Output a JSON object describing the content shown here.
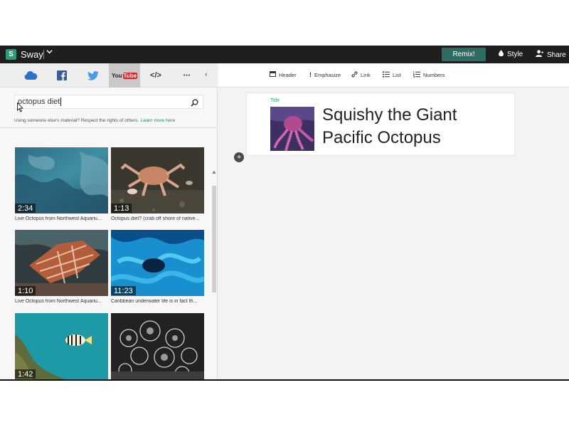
{
  "colors": {
    "topbar": "#1f1f1f",
    "accent": "#2e6b62",
    "link": "#1a8a6c",
    "title_label": "#2e9a7e"
  },
  "app": {
    "name": "Sway",
    "logo_letter": "S"
  },
  "topbar": {
    "remix_label": "Remix!",
    "style_label": "Style",
    "share_label": "Share"
  },
  "sources": {
    "tabs": [
      {
        "name": "onedrive",
        "icon": "cloud-icon"
      },
      {
        "name": "facebook",
        "icon": "facebook-icon"
      },
      {
        "name": "twitter",
        "icon": "twitter-icon"
      },
      {
        "name": "youtube",
        "icon": "youtube-icon",
        "active": true
      },
      {
        "name": "embed",
        "icon": "code-icon"
      },
      {
        "name": "more",
        "icon": "more-icon"
      }
    ],
    "youtube_text": "You",
    "youtube_tube": "Tube",
    "embed_text": "</>",
    "more_text": "•••",
    "collapse_text": "‹"
  },
  "search": {
    "value": "octopus diet"
  },
  "notice": {
    "text": "Using someone else's material? Respect the rights of others.",
    "link": "Learn more here"
  },
  "results": [
    {
      "duration": "2:34",
      "caption": "Live Octopus from Northwest Aquariu..."
    },
    {
      "duration": "1:13",
      "caption": "Octopus diet? (crab off shore of native..."
    },
    {
      "duration": "1:10",
      "caption": "Live Octopus from Northwest Aquariu..."
    },
    {
      "duration": "11:23",
      "caption": "Caribbean underwater life is in fact th..."
    },
    {
      "duration": "1:42",
      "caption": ""
    },
    {
      "duration": "",
      "caption": ""
    }
  ],
  "format_toolbar": {
    "header": "Header",
    "emphasize": "Emphasize",
    "link": "Link",
    "list": "List",
    "numbers": "Numbers"
  },
  "title_card": {
    "label": "Title",
    "line1": "Squishy the Giant",
    "line2": "Pacific Octopus"
  },
  "add_card_symbol": "+"
}
